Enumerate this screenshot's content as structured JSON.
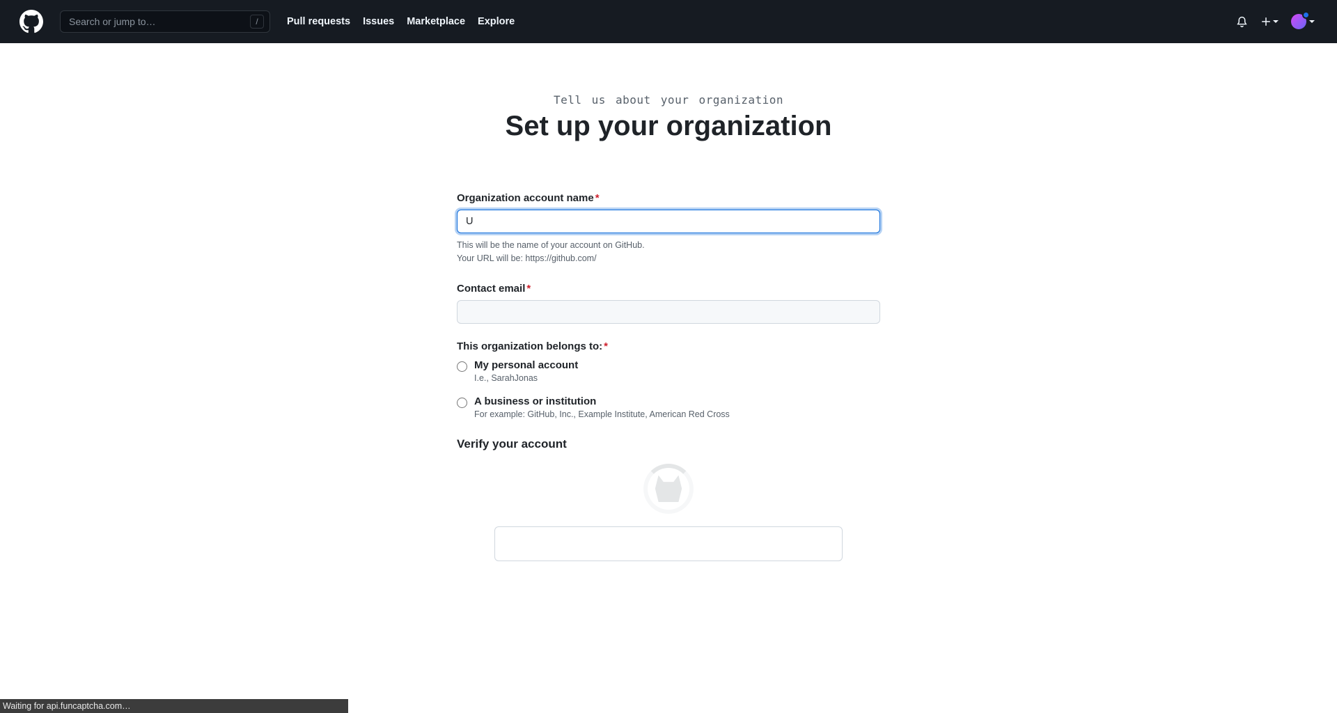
{
  "header": {
    "search_placeholder": "Search or jump to…",
    "slash_key": "/",
    "nav": {
      "pulls": "Pull requests",
      "issues": "Issues",
      "marketplace": "Marketplace",
      "explore": "Explore"
    }
  },
  "page": {
    "subtitle": "Tell us about your organization",
    "title": "Set up your organization"
  },
  "form": {
    "org_name": {
      "label": "Organization account name",
      "value": "U",
      "note1": "This will be the name of your account on GitHub.",
      "note2": "Your URL will be: https://github.com/"
    },
    "email": {
      "label": "Contact email",
      "value": ""
    },
    "belongs": {
      "label": "This organization belongs to:",
      "options": {
        "personal": {
          "label": "My personal account",
          "sub": "I.e., SarahJonas"
        },
        "business": {
          "label": "A business or institution",
          "sub": "For example: GitHub, Inc., Example Institute, American Red Cross"
        }
      }
    },
    "verify_heading": "Verify your account"
  },
  "status_bar": "Waiting for api.funcaptcha.com…"
}
